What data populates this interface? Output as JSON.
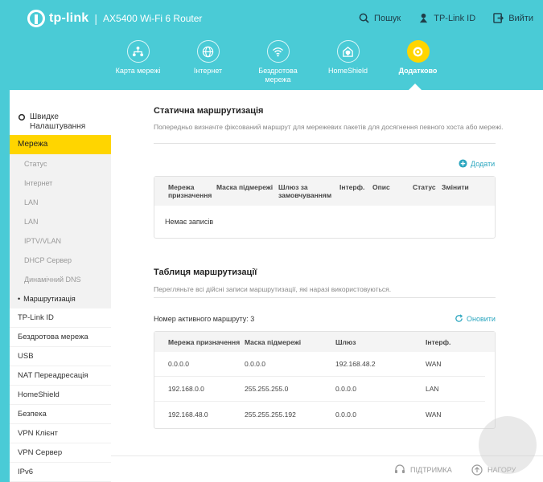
{
  "header": {
    "brand": "tp-link",
    "separator": "|",
    "model": "AX5400 Wi-Fi 6 Router",
    "actions": [
      {
        "label": "Пошук",
        "icon": "search-icon"
      },
      {
        "label": "TP-Link ID",
        "icon": "tplink-id-icon"
      },
      {
        "label": "Вийти",
        "icon": "logout-icon"
      }
    ]
  },
  "nav": [
    {
      "line1": "Карта мережі",
      "line2": "",
      "icon": "network-map-icon"
    },
    {
      "line1": "Інтернет",
      "line2": "",
      "icon": "globe-icon"
    },
    {
      "line1": "Бездротова",
      "line2": "мережа",
      "icon": "wifi-icon"
    },
    {
      "line1": "HomeShield",
      "line2": "",
      "icon": "homeshield-icon"
    },
    {
      "line1": "Додатково",
      "line2": "",
      "icon": "gear-icon",
      "active": true
    }
  ],
  "sidebar": {
    "quick_line1": "Швидке",
    "quick_line2": "Налаштування",
    "network": "Мережа",
    "sub": [
      "Статус",
      "Інтернет",
      "LAN",
      "LAN",
      "IPTV/VLAN",
      "DHCP Сервер",
      "Динамічний DNS",
      "Маршрутизація"
    ],
    "items": [
      "TP-Link ID",
      "Бездротова мережа",
      "USB",
      "NAT Переадресація",
      "HomeShield",
      "Безпека",
      "VPN Клієнт",
      "VPN Сервер",
      "IPv6"
    ]
  },
  "static_routing": {
    "title": "Статична маршрутизація",
    "desc": "Попередньо визначте фіксований маршрут для мережевих пакетів для досягнення певного хоста або мережі.",
    "add": "Додати",
    "columns": [
      {
        "l1": "Мережа",
        "l2": "призначення"
      },
      {
        "l1": "Маска підмережі",
        "l2": ""
      },
      {
        "l1": "Шлюз за",
        "l2": "замовчуванням"
      },
      {
        "l1": "Інтерф.",
        "l2": ""
      },
      {
        "l1": "Опис",
        "l2": ""
      },
      {
        "l1": "Статус",
        "l2": ""
      },
      {
        "l1": "Змінити",
        "l2": ""
      }
    ],
    "empty": "Немає записів"
  },
  "routing_table": {
    "title": "Таблиця маршрутизації",
    "desc": "Перегляньте всі дійсні записи маршрутизації, які наразі використовуються.",
    "active_count": "Номер активного маршруту: 3",
    "refresh": "Оновити",
    "columns": [
      "Мережа призначення",
      "Маска підмережі",
      "Шлюз",
      "Інтерф."
    ],
    "rows": [
      [
        "0.0.0.0",
        "0.0.0.0",
        "192.168.48.2",
        "WAN"
      ],
      [
        "192.168.0.0",
        "255.255.255.0",
        "0.0.0.0",
        "LAN"
      ],
      [
        "192.168.48.0",
        "255.255.255.192",
        "0.0.0.0",
        "WAN"
      ]
    ]
  },
  "footer": {
    "support": "ПІДТРИМКА",
    "top": "НАГОРУ"
  },
  "colors": {
    "header_bg": "#4acbd6",
    "accent": "#ffd500",
    "link": "#2ba6bf"
  }
}
